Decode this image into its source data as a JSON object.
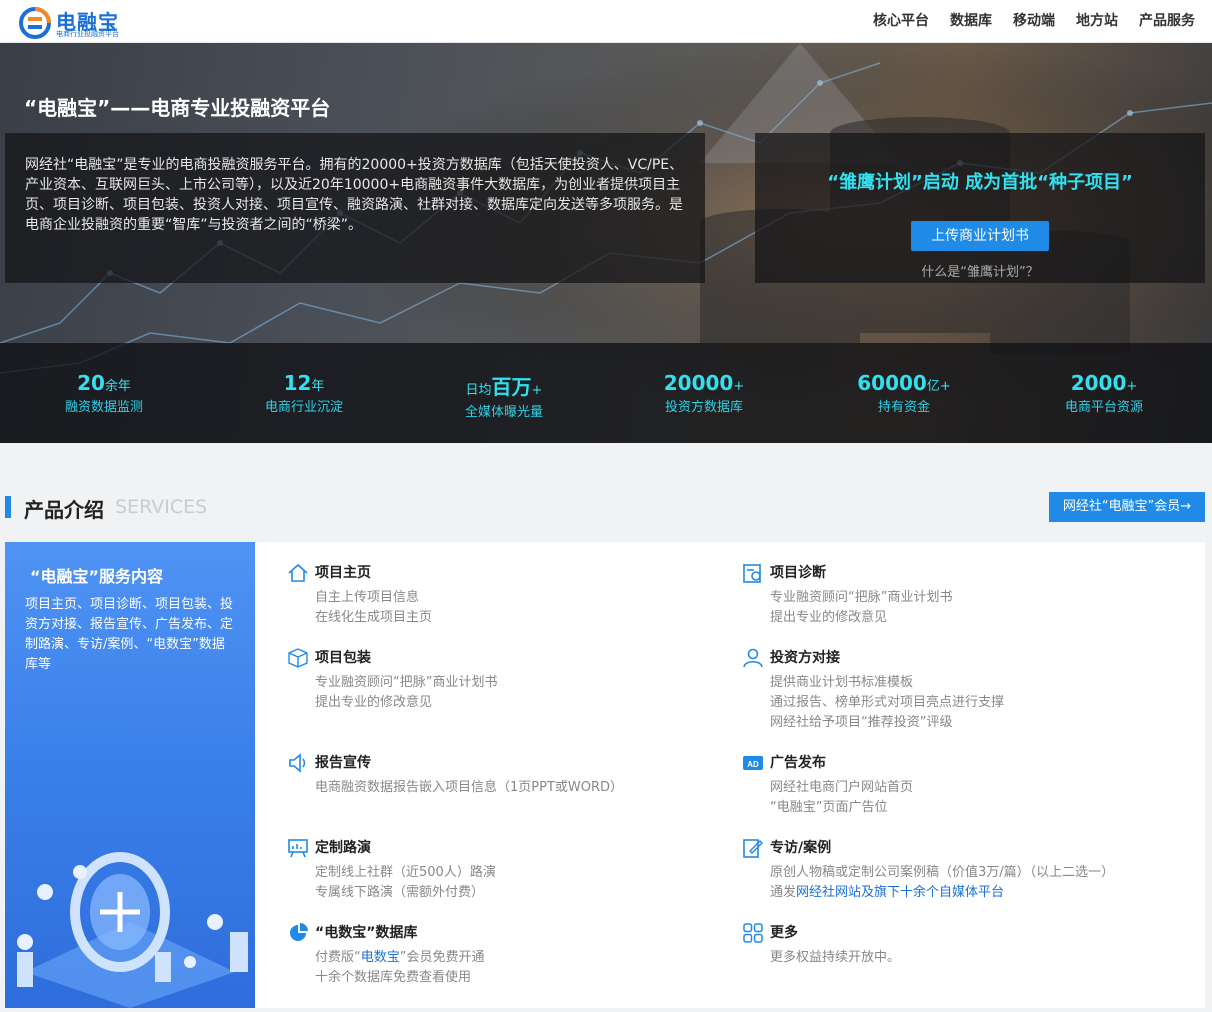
{
  "header": {
    "logo_title": "电融宝",
    "logo_subtitle": "电商行业投融资平台",
    "nav": [
      "核心平台",
      "数据库",
      "移动端",
      "地方站",
      "产品服务"
    ]
  },
  "hero": {
    "title": "“电融宝”——电商专业投融资平台",
    "intro": "网经社“电融宝”是专业的电商投融资服务平台。拥有的20000+投资方数据库（包括天使投资人、VC/PE、产业资本、互联网巨头、上市公司等），以及近20年10000+电商融资事件大数据库，为创业者提供项目主页、项目诊断、项目包装、投资人对接、项目宣传、融资路演、社群对接、数据库定向发送等多项服务。是电商企业投融资的重要“智库”与投资者之间的“桥梁”。",
    "eagle_title": "“雏鹰计划”启动 成为首批“种子项目”",
    "upload_button": "上传商业计划书",
    "eagle_link": "什么是“雏鹰计划”？"
  },
  "stats": [
    {
      "prefix": "",
      "big": "20",
      "suffix": "余年",
      "label": "融资数据监测"
    },
    {
      "prefix": "",
      "big": "12",
      "suffix": "年",
      "label": "电商行业沉淀"
    },
    {
      "prefix": "日均",
      "big": "百万",
      "suffix": "+",
      "label": "全媒体曝光量"
    },
    {
      "prefix": "",
      "big": "20000",
      "suffix": "+",
      "label": "投资方数据库"
    },
    {
      "prefix": "",
      "big": "60000",
      "suffix": "亿+",
      "label": "持有资金"
    },
    {
      "prefix": "",
      "big": "2000",
      "suffix": "+",
      "label": "电商平台资源"
    }
  ],
  "services": {
    "title": "产品介绍",
    "subtitle": "SERVICES",
    "member_button": "网经社“电融宝”会员→",
    "side_title": "“电融宝”服务内容",
    "side_desc": "项目主页、项目诊断、项目包装、投资方对接、报告宣传、广告发布、定制路演、专访/案例、“电数宝”数据库等",
    "items": [
      {
        "icon": "home-icon",
        "title": "项目主页",
        "lines": [
          "自主上传项目信息",
          "在线化生成项目主页"
        ]
      },
      {
        "icon": "diagnosis-icon",
        "title": "项目诊断",
        "lines": [
          "专业融资顾问“把脉”商业计划书",
          "提出专业的修改意见"
        ]
      },
      {
        "icon": "package-icon",
        "title": "项目包装",
        "lines": [
          "专业融资顾问“把脉”商业计划书",
          "提出专业的修改意见"
        ]
      },
      {
        "icon": "investor-icon",
        "title": "投资方对接",
        "lines": [
          "提供商业计划书标准模板",
          "通过报告、榜单形式对项目亮点进行支撑",
          "网经社给予项目“推荐投资”评级"
        ]
      },
      {
        "icon": "speaker-icon",
        "title": "报告宣传",
        "lines": [
          "电商融资数据报告嵌入项目信息（1页PPT或WORD）"
        ]
      },
      {
        "icon": "ad-icon",
        "title": "广告发布",
        "lines": [
          "网经社电商门户网站首页",
          "“电融宝”页面广告位"
        ]
      },
      {
        "icon": "roadshow-icon",
        "title": "定制路演",
        "lines": [
          "定制线上社群（近500人）路演",
          "专属线下路演（需额外付费）"
        ]
      },
      {
        "icon": "interview-icon",
        "title": "专访/案例",
        "lines": [
          "原创人物稿或定制公司案例稿（价值3万/篇）（以上二选一）"
        ],
        "line2_plain": "通发",
        "line2_hl": "网经社网站及旗下十余个自媒体平台"
      },
      {
        "icon": "pie-icon",
        "title": "“电数宝”数据库",
        "line1_plain": "付费版“",
        "line1_hl": "电数宝",
        "line1_tail": "”会员免费开通",
        "lines": [
          "十余个数据库免费查看使用"
        ]
      },
      {
        "icon": "more-icon",
        "title": "更多",
        "lines": [
          "更多权益持续开放中。"
        ]
      }
    ]
  },
  "colors": {
    "accent": "#1f8be6",
    "cyan": "#32e0f0",
    "brand": "#1a6fd8"
  }
}
